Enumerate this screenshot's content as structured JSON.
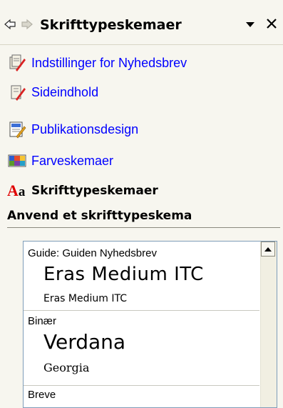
{
  "header": {
    "title": "Skrifttypeskemaer",
    "back_icon": "back-arrow-icon",
    "forward_icon": "forward-arrow-icon",
    "menu_icon": "dropdown-triangle-icon",
    "close_glyph": "×"
  },
  "nav": {
    "items": [
      {
        "label": "Indstillinger for Nyhedsbrev",
        "icon": "newsletter-options-icon"
      },
      {
        "label": "Sideindhold",
        "icon": "page-content-icon"
      },
      {
        "label": "Publikationsdesign",
        "icon": "publication-design-icon"
      },
      {
        "label": "Farveskemaer",
        "icon": "color-scheme-icon"
      },
      {
        "label": "Skrifttypeskemaer",
        "icon": "font-scheme-icon",
        "current": true
      }
    ],
    "aa_big": "A",
    "aa_small": "a"
  },
  "section": {
    "heading": "Anvend et skrifttypeskema"
  },
  "schemes": [
    {
      "label": "Guide: Guiden Nyhedsbrev",
      "heading_font": "Eras Medium ITC",
      "body_font": "Eras Medium ITC"
    },
    {
      "label": "Binær",
      "heading_font": "Verdana",
      "body_font": "Georgia"
    },
    {
      "label": "Breve",
      "heading_font": "",
      "body_font": ""
    }
  ],
  "colors": {
    "link": "#0000ff",
    "pane_bg": "#f7f6ef",
    "listbox_border": "#7f9db9",
    "aa_red": "#e00000"
  }
}
